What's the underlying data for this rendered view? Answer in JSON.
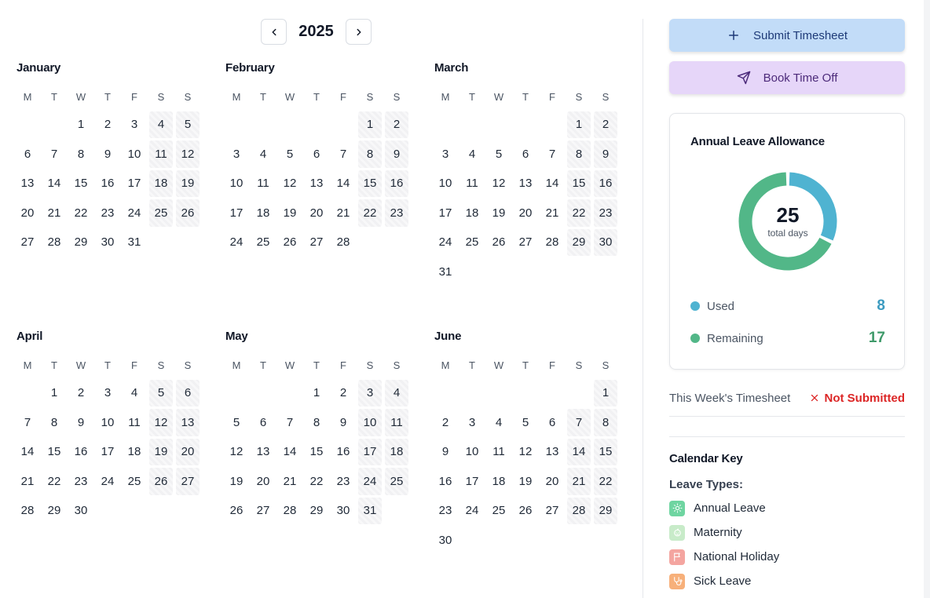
{
  "year": "2025",
  "weekday_headers": [
    "M",
    "T",
    "W",
    "T",
    "F",
    "S",
    "S"
  ],
  "months": [
    {
      "name": "January",
      "offset": 2,
      "days": 31
    },
    {
      "name": "February",
      "offset": 5,
      "days": 28
    },
    {
      "name": "March",
      "offset": 5,
      "days": 31
    },
    {
      "name": "April",
      "offset": 1,
      "days": 30
    },
    {
      "name": "May",
      "offset": 3,
      "days": 31
    },
    {
      "name": "June",
      "offset": 6,
      "days": 30
    }
  ],
  "actions": {
    "submit_label": "Submit Timesheet",
    "book_label": "Book Time Off"
  },
  "allowance": {
    "title": "Annual Leave Allowance",
    "total": "25",
    "total_caption": "total days",
    "used_label": "Used",
    "used_value": "8",
    "remaining_label": "Remaining",
    "remaining_value": "17",
    "used_color": "#4fb3d1",
    "remaining_color": "#52b788"
  },
  "timesheet": {
    "label": "This Week's Timesheet",
    "status": "Not Submitted",
    "status_color": "#dc2626"
  },
  "calendar_key": {
    "title": "Calendar Key",
    "leave_types_label": "Leave Types:",
    "items": [
      {
        "label": "Annual Leave",
        "color": "#6fd5a1",
        "icon": "sun-icon"
      },
      {
        "label": "Maternity",
        "color": "#c8ebc9",
        "icon": "baby-icon"
      },
      {
        "label": "National Holiday",
        "color": "#f4a5a0",
        "icon": "flag-icon"
      },
      {
        "label": "Sick Leave",
        "color": "#f7b07a",
        "icon": "stethoscope-icon"
      }
    ]
  }
}
